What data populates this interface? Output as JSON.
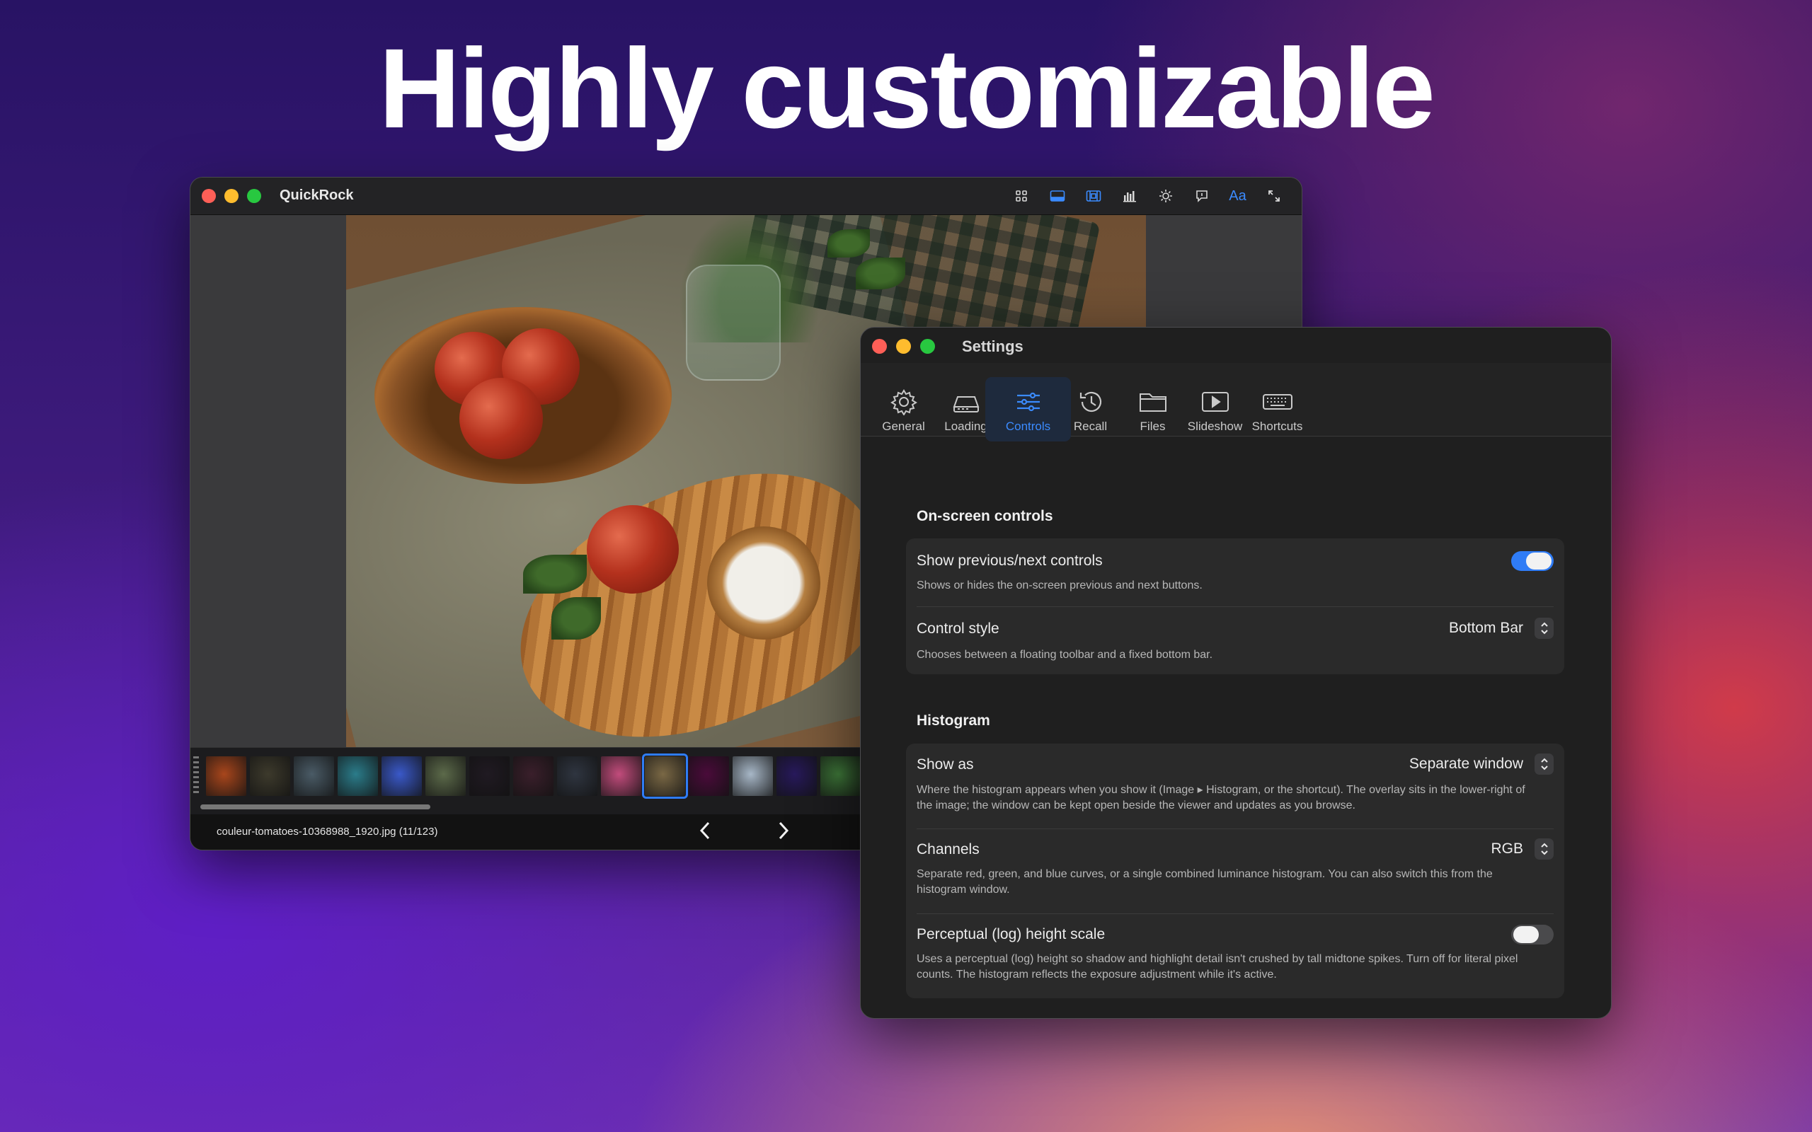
{
  "headline": "Highly customizable",
  "viewer": {
    "title": "QuickRock",
    "toolbar": [
      {
        "icon": "grid-icon",
        "active": false
      },
      {
        "icon": "bottom-bar-icon",
        "active": true
      },
      {
        "icon": "filmstrip-icon",
        "active": true
      },
      {
        "icon": "histogram-icon",
        "active": false
      },
      {
        "icon": "brightness-icon",
        "active": false
      },
      {
        "icon": "info-bubble-icon",
        "active": false
      },
      {
        "icon": "text-size-icon",
        "label": "Aa",
        "active": true
      },
      {
        "icon": "fullscreen-icon",
        "active": false
      }
    ],
    "filename": "couleur-tomatoes-10368988_1920.jpg (11/123)",
    "thumbnails": [
      {
        "color": "#a8461c"
      },
      {
        "color": "#3d3a2c"
      },
      {
        "color": "#4a5b66"
      },
      {
        "color": "#2b7c8a"
      },
      {
        "color": "#3a59c9"
      },
      {
        "color": "#5c6a4a"
      },
      {
        "color": "#201a22"
      },
      {
        "color": "#3a1f2b"
      },
      {
        "color": "#2f3540"
      },
      {
        "color": "#c24c7c"
      },
      {
        "color": "#7a6845",
        "selected": true
      },
      {
        "color": "#4a0b3a"
      },
      {
        "color": "#a7b7c7"
      },
      {
        "color": "#281a5c"
      },
      {
        "color": "#3f7a3a"
      }
    ]
  },
  "settings": {
    "title": "Settings",
    "tabs": [
      {
        "label": "General",
        "icon": "gear-icon"
      },
      {
        "label": "Loading",
        "icon": "drive-icon"
      },
      {
        "label": "Controls",
        "icon": "sliders-icon",
        "active": true
      },
      {
        "label": "Recall",
        "icon": "history-icon"
      },
      {
        "label": "Files",
        "icon": "folder-icon"
      },
      {
        "label": "Slideshow",
        "icon": "play-icon"
      },
      {
        "label": "Shortcuts",
        "icon": "keyboard-icon"
      }
    ],
    "onscreen": {
      "heading": "On-screen controls",
      "show_prev_next": {
        "title": "Show previous/next controls",
        "desc": "Shows or hides the on-screen previous and next buttons.",
        "enabled": true
      },
      "control_style": {
        "title": "Control style",
        "desc": "Chooses between a floating toolbar and a fixed bottom bar.",
        "value": "Bottom Bar"
      }
    },
    "histogram": {
      "heading": "Histogram",
      "show_as": {
        "title": "Show as",
        "desc": "Where the histogram appears when you show it (Image ▸ Histogram, or the shortcut). The overlay sits in the lower-right of the image; the window can be kept open beside the viewer and updates as you browse.",
        "value": "Separate window"
      },
      "channels": {
        "title": "Channels",
        "desc": "Separate red, green, and blue curves, or a single combined luminance histogram. You can also switch this from the histogram window.",
        "value": "RGB"
      },
      "log_scale": {
        "title": "Perceptual (log) height scale",
        "desc": "Uses a perceptual (log) height so shadow and highlight detail isn't crushed by tall midtone spikes. Turn off for literal pixel counts. The histogram reflects the exposure adjustment while it's active.",
        "enabled": false
      }
    }
  }
}
